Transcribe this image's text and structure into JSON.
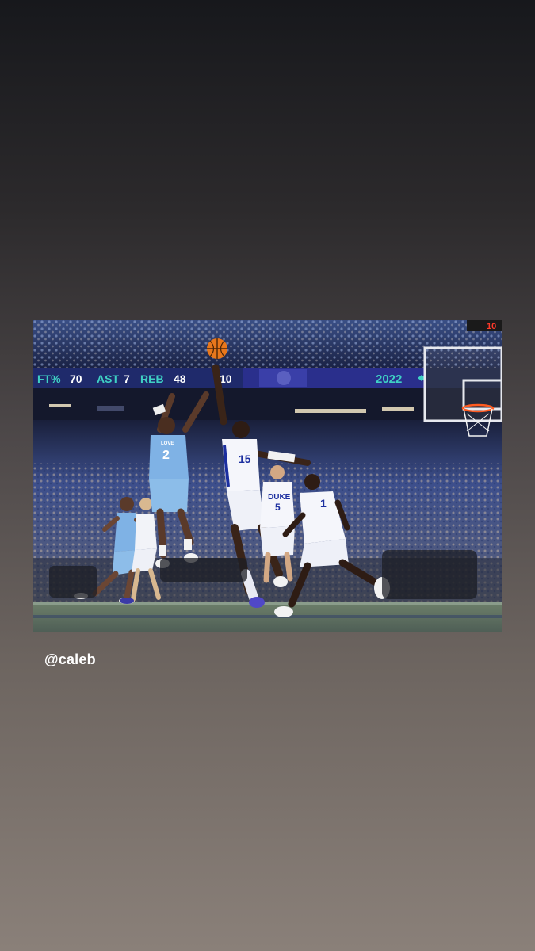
{
  "story": {
    "mention": "@caleb"
  },
  "photo": {
    "scoreboard": {
      "ft_label": "FT%",
      "ft_value": "70",
      "ast_label": "AST",
      "ast_value": "7",
      "reb_label": "REB",
      "reb_value": "48",
      "extra_value": "10",
      "year": "2022"
    },
    "shot_clock": "10",
    "jerseys": {
      "shooter_number": "2",
      "shooter_name": "LOVE",
      "defender_number": "15",
      "center_team": "DUKE",
      "center_number": "5",
      "right_number": "1"
    },
    "colors": {
      "carolina_blue": "#7fb2e5",
      "duke_blue": "#1c2fa0",
      "scoreboard_teal": "#3fd0c4"
    }
  }
}
